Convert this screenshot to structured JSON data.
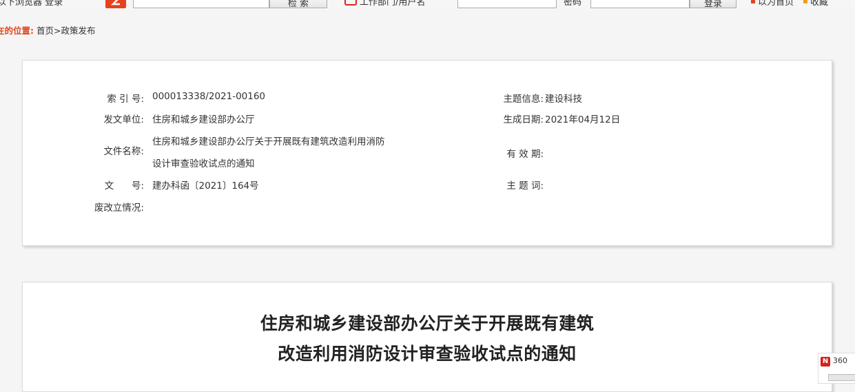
{
  "topbar": {
    "left_text": "以下浏览器 登录",
    "search_button": "检  索",
    "mid_text": "工作部门/用户名",
    "pwd_text": "密码",
    "login_button": "登录",
    "right_text_1": "以为首页",
    "right_text_2": "收藏"
  },
  "breadcrumb": {
    "label": "在的位置:",
    "path": "首页>政策发布"
  },
  "meta": {
    "index_no_label": "索 引 号:",
    "index_no": "000013338/2021-00160",
    "issuer_label": "发文单位:",
    "issuer": "住房和城乡建设部办公厅",
    "file_name_label": "文件名称:",
    "file_name_line1": "住房和城乡建设部办公厅关于开展既有建筑改造利用消防",
    "file_name_line2": "设计审查验收试点的通知",
    "doc_no_label": "文      号:",
    "doc_no": "建办科函〔2021〕164号",
    "status_label": "废改立情况:",
    "status": "",
    "topic_label": "主题信息:",
    "topic": "建设科技",
    "date_label": "生成日期:",
    "date": "2021年04月12日",
    "validity_label": "有 效 期:",
    "validity": "",
    "keywords_label": "主 题 词:",
    "keywords": ""
  },
  "document": {
    "title_line1": "住房和城乡建设部办公厅关于开展既有建筑",
    "title_line2": "改造利用消防设计审查验收试点的通知"
  },
  "widget": {
    "icon_letter": "N",
    "text": "360"
  },
  "colors": {
    "accent": "#e04a1f",
    "logo_red": "#e8411e",
    "card_bg": "#ffffff",
    "page_bg": "#f5f5f5"
  }
}
